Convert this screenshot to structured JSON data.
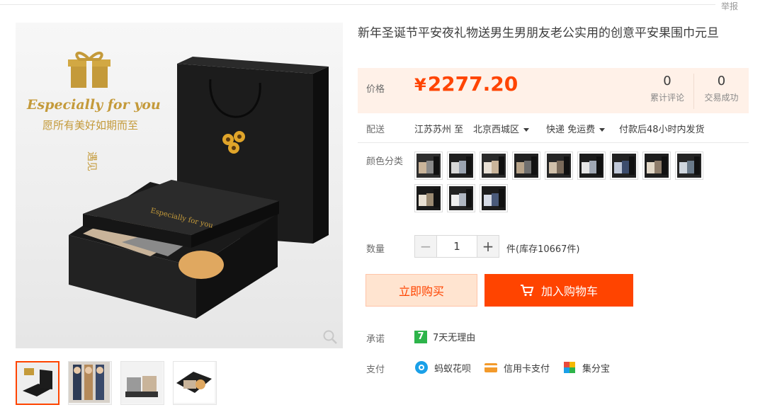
{
  "header": {
    "report_label": "举报"
  },
  "product": {
    "title": "新年圣诞节平安夜礼物送男生男朋友老公实用的创意平安果围巾元旦",
    "image_text": {
      "line1": "Especially for you",
      "line2": "愿所有美好如期而至",
      "stamp": "遇见"
    }
  },
  "price": {
    "label": "价格",
    "currency": "¥",
    "amount": "2277.20",
    "reviews_count": "0",
    "reviews_label": "累计评论",
    "sales_count": "0",
    "sales_label": "交易成功"
  },
  "shipping": {
    "label": "配送",
    "from": "江苏苏州 至",
    "to": "北京西城区",
    "method": "快递 免运费",
    "time": "付款后48小时内发货"
  },
  "color": {
    "label": "颜色分类",
    "swatch_count": 12
  },
  "quantity": {
    "label": "数量",
    "minus": "−",
    "value": "1",
    "plus": "+",
    "stock": "件(库存10667件)"
  },
  "actions": {
    "buy": "立即购买",
    "cart": "加入购物车"
  },
  "promise": {
    "label": "承诺",
    "badge": "7",
    "text": "7天无理由"
  },
  "payment": {
    "label": "支付",
    "methods": [
      "蚂蚁花呗",
      "信用卡支付",
      "集分宝"
    ]
  },
  "colors": {
    "accent": "#ff4400",
    "price_bg": "#fff1e8",
    "promise_green": "#2db44a"
  }
}
